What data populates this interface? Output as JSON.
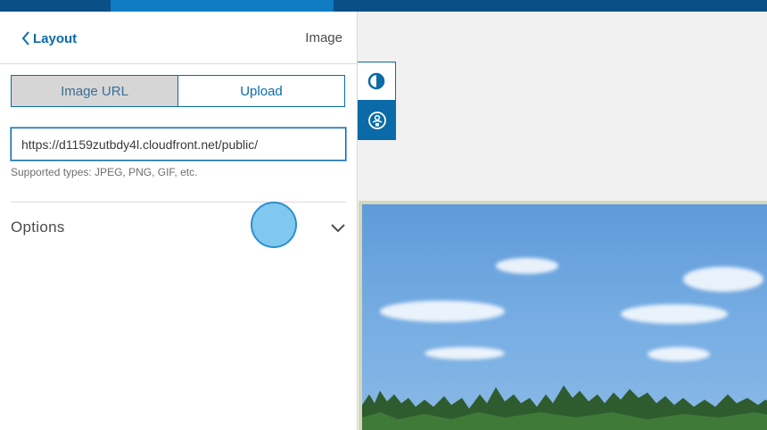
{
  "panel": {
    "back_label": "Layout",
    "title": "Image"
  },
  "source_tabs": [
    {
      "label": "Image URL",
      "active": true
    },
    {
      "label": "Upload",
      "active": false
    }
  ],
  "url_field": {
    "value": "https://d1159zutbdy4l.cloudfront.net/public/"
  },
  "hint": "Supported types: JPEG, PNG, GIF, etc.",
  "options": {
    "label": "Options"
  },
  "colors": {
    "accent": "#0b6aa8",
    "topbar": "#0a4f86",
    "topbar_active": "#0f7cc3"
  },
  "icons": {
    "back": "chevron-left-icon",
    "expand": "chevron-down-icon",
    "contrast": "contrast-icon",
    "accessibility": "accessibility-icon"
  }
}
